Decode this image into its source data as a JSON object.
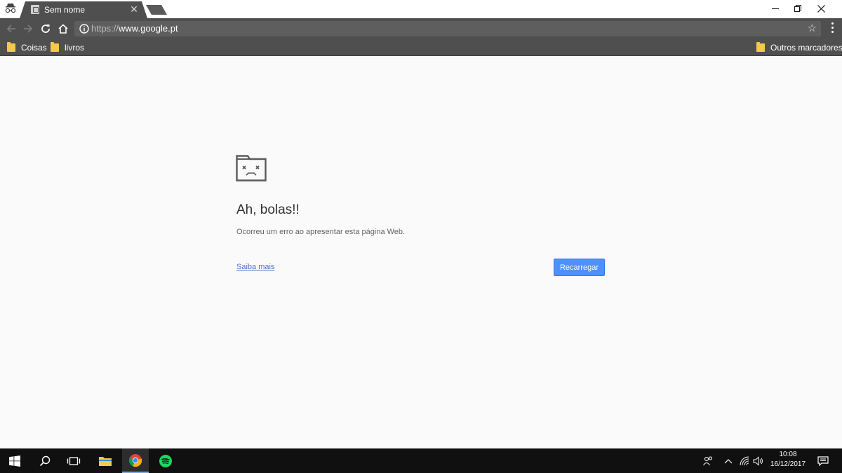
{
  "browser": {
    "tab": {
      "title": "Sem nome",
      "close_glyph": "✕"
    },
    "toolbar": {
      "url_scheme": "https://",
      "url_host": "www.google.pt"
    },
    "bookmarks": [
      {
        "label": "Coisas",
        "icon": "folder-icon"
      },
      {
        "label": "livros",
        "icon": "folder-icon"
      }
    ],
    "other_bookmarks": {
      "label": "Outros marcadores",
      "icon": "folder-icon"
    }
  },
  "error_page": {
    "icon": "sad-tab-icon",
    "title": "Ah, bolas!!",
    "message": "Ocorreu um erro ao apresentar esta página Web.",
    "learn_more": "Saiba mais",
    "reload_label": "Recarregar"
  },
  "taskbar": {
    "apps": [
      "start-icon",
      "search-icon",
      "task-view-icon",
      "file-explorer-icon",
      "chrome-icon",
      "spotify-icon"
    ],
    "clock": {
      "time": "10:08",
      "date": "16/12/2017"
    }
  },
  "colors": {
    "chrome_frame": "#4f4f4f",
    "page_background": "#fafafa",
    "accent_blue": "#4d90fe",
    "folder_yellow": "#f4c84a"
  }
}
